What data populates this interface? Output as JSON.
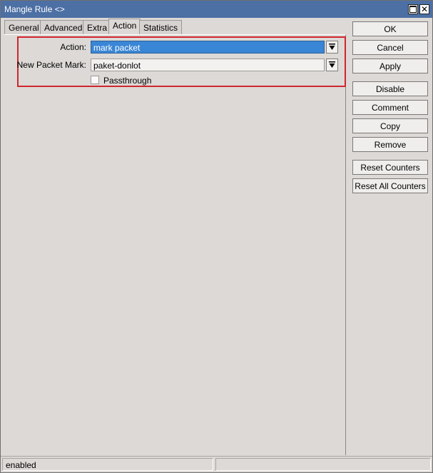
{
  "window": {
    "title": "Mangle Rule <>"
  },
  "tabs": [
    {
      "label": "General"
    },
    {
      "label": "Advanced"
    },
    {
      "label": "Extra"
    },
    {
      "label": "Action"
    },
    {
      "label": "Statistics"
    }
  ],
  "active_tab": "Action",
  "form": {
    "action_label": "Action:",
    "action_value": "mark packet",
    "new_packet_mark_label": "New Packet Mark:",
    "new_packet_mark_value": "paket-donlot",
    "passthrough_label": "Passthrough",
    "passthrough_checked": false
  },
  "buttons": {
    "ok": "OK",
    "cancel": "Cancel",
    "apply": "Apply",
    "disable": "Disable",
    "comment": "Comment",
    "copy": "Copy",
    "remove": "Remove",
    "reset_counters": "Reset Counters",
    "reset_all_counters": "Reset All Counters"
  },
  "status": {
    "state": "enabled",
    "extra": ""
  },
  "colors": {
    "titlebar": "#4c6fa4",
    "highlight_border": "#d0262e",
    "selection": "#3a86d6"
  }
}
